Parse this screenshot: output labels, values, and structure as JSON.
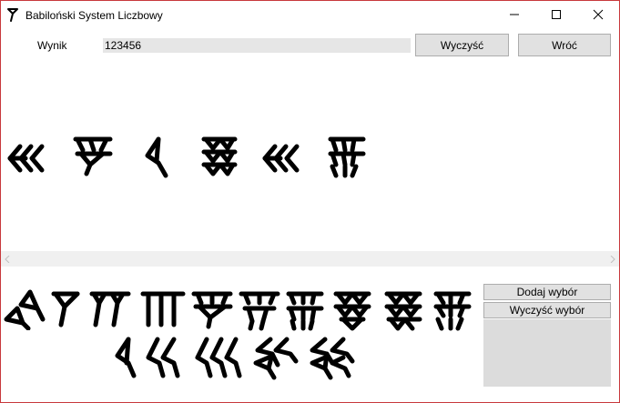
{
  "window": {
    "title": "Babiloński System Liczbowy",
    "icon": "babylonian-wedge-icon",
    "controls": [
      "minimize-icon",
      "maximize-icon",
      "close-icon"
    ],
    "border_color": "#c8393c"
  },
  "result": {
    "label": "Wynik",
    "value": "123456"
  },
  "buttons": {
    "clear": "Wyczyść",
    "back": "Wróć",
    "add_selection": "Dodaj wybór",
    "clear_selection": "Wyczyść wybór"
  },
  "display_glyphs": [
    "tens-30",
    "units-4",
    "tens-10",
    "units-9",
    "tens-30",
    "units-6"
  ],
  "palette": {
    "units": [
      "zero-sign",
      "units-1",
      "units-2",
      "units-3",
      "units-4",
      "units-5",
      "units-6",
      "units-7",
      "units-8",
      "units-9"
    ],
    "tens": [
      "tens-10",
      "tens-20",
      "tens-30",
      "tens-40",
      "tens-50"
    ]
  },
  "scrollbar_icons": [
    "scroll-left-arrow-icon",
    "scroll-right-arrow-icon"
  ]
}
